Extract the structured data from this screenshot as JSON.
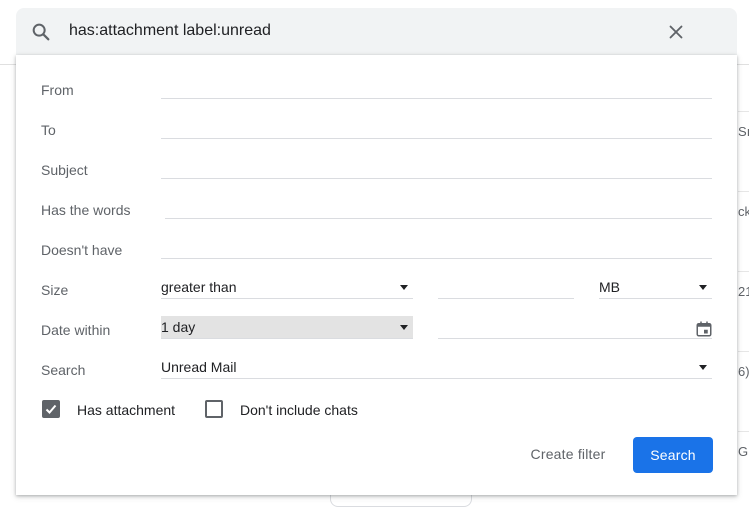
{
  "search": {
    "query": "has:attachment label:unread"
  },
  "form": {
    "from_label": "From",
    "to_label": "To",
    "subject_label": "Subject",
    "has_words_label": "Has the words",
    "doesnt_have_label": "Doesn't have",
    "size_label": "Size",
    "size_operator": "greater than",
    "size_unit": "MB",
    "date_within_label": "Date within",
    "date_within_value": "1 day",
    "search_label": "Search",
    "search_scope": "Unread Mail",
    "has_attachment_label": "Has attachment",
    "has_attachment_checked": true,
    "dont_include_chats_label": "Don't include chats",
    "dont_include_chats_checked": false
  },
  "actions": {
    "create_filter_label": "Create filter",
    "search_button_label": "Search"
  },
  "background_edge_text": [
    "Sı",
    "ck",
    "21",
    "6)",
    "G"
  ],
  "colors": {
    "primary": "#1a73e8",
    "search_bar_bg": "#f1f3f4",
    "label_gray": "#5f6368"
  },
  "icons": [
    "search-icon",
    "close-icon",
    "calendar-icon",
    "dropdown-caret-icon",
    "checkmark-icon"
  ]
}
